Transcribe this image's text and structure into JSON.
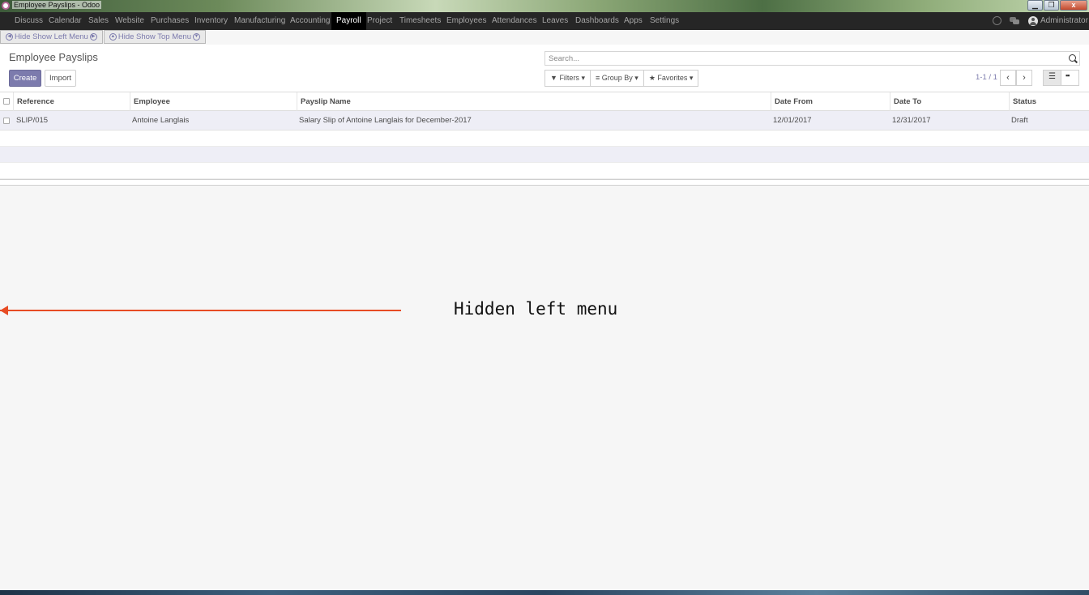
{
  "window": {
    "title": "Employee Payslips - Odoo",
    "controls": [
      "▁",
      "❐",
      "x"
    ]
  },
  "top_menu": {
    "items": [
      "Discuss",
      "Calendar",
      "Sales",
      "Website",
      "Purchases",
      "Inventory",
      "Manufacturing",
      "Accounting",
      "Payroll",
      "Project",
      "Timesheets",
      "Employees",
      "Attendances",
      "Leaves",
      "Dashboards",
      "Apps",
      "Settings"
    ],
    "active": "Payroll",
    "user": "Administrator"
  },
  "toggles": {
    "left_menu": "Hide Show Left Menu",
    "top_menu": "Hide Show Top Menu"
  },
  "control_panel": {
    "title": "Employee Payslips",
    "create_label": "Create",
    "import_label": "Import",
    "search_placeholder": "Search...",
    "filters_label": "Filters",
    "groupby_label": "Group By",
    "favorites_label": "Favorites",
    "pager": "1-1 / 1"
  },
  "table": {
    "columns": [
      "Reference",
      "Employee",
      "Payslip Name",
      "Date From",
      "Date To",
      "Status"
    ],
    "rows": [
      [
        "SLIP/015",
        "Antoine Langlais",
        "Salary Slip of Antoine Langlais for December-2017",
        "12/01/2017",
        "12/31/2017",
        "Draft"
      ]
    ]
  },
  "annotation": {
    "text": "Hidden left menu",
    "color": "#e74c24"
  },
  "colors": {
    "brand": "#7c7bad",
    "menu_bg": "#262626"
  }
}
